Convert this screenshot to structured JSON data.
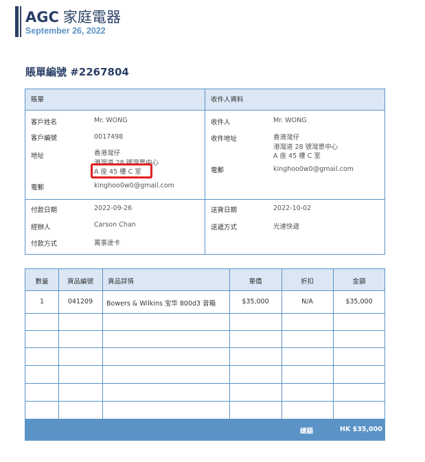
{
  "header": {
    "brand_en": "AGC",
    "brand_zh": "家庭電器",
    "date": "September 26, 2022"
  },
  "invoice": {
    "title": "賬單編號 #2267804"
  },
  "billing": {
    "heading": "賬單",
    "customer_name_label": "客戶姓名",
    "customer_name": "Mr. WONG",
    "customer_no_label": "客戶編號",
    "customer_no": "0017498",
    "address_label": "地址",
    "address_line1": "香港灣仔",
    "address_line2": "港灣道 28 號灣景中心",
    "address_line3": "A 座 45 樓 C 室",
    "email_label": "電郵",
    "email": "kinghoo0w0@gmail.com",
    "pay_date_label": "付款日期",
    "pay_date": "2022-09-26",
    "handler_label": "經辦人",
    "handler": "Carson Chan",
    "pay_method_label": "付款方式",
    "pay_method": "萬事達卡"
  },
  "recipient": {
    "heading": "收件人資料",
    "name_label": "收件人",
    "name": "Mr. WONG",
    "address_label": "收件地址",
    "address_line1": "香港灣仔",
    "address_line2": "港灣道 28 號灣景中心",
    "address_line3": "A 座 45 樓 C 室",
    "email_label": "電郵",
    "email": "kinghoo0w0@gmail.com",
    "ship_date_label": "送貨日期",
    "ship_date": "2022-10-02",
    "ship_method_label": "送遞方式",
    "ship_method": "光速快遞"
  },
  "items_table": {
    "columns": [
      "數量",
      "貨品編號",
      "貨品詳情",
      "單價",
      "折扣",
      "金額"
    ],
    "rows": [
      {
        "qty": "1",
        "code": "041209",
        "detail": "Bowers & Wilkins 宝华 800d3 音箱",
        "price": "$35,000",
        "discount": "N/A",
        "amount": "$35,000"
      }
    ],
    "total_label": "總額",
    "total_value": "HK $35,000"
  },
  "colors": {
    "brand_navy": "#2a3f66",
    "accent_blue": "#5b93c7",
    "header_fill": "#dbe7f4",
    "highlight_red": "#e41e1e"
  }
}
